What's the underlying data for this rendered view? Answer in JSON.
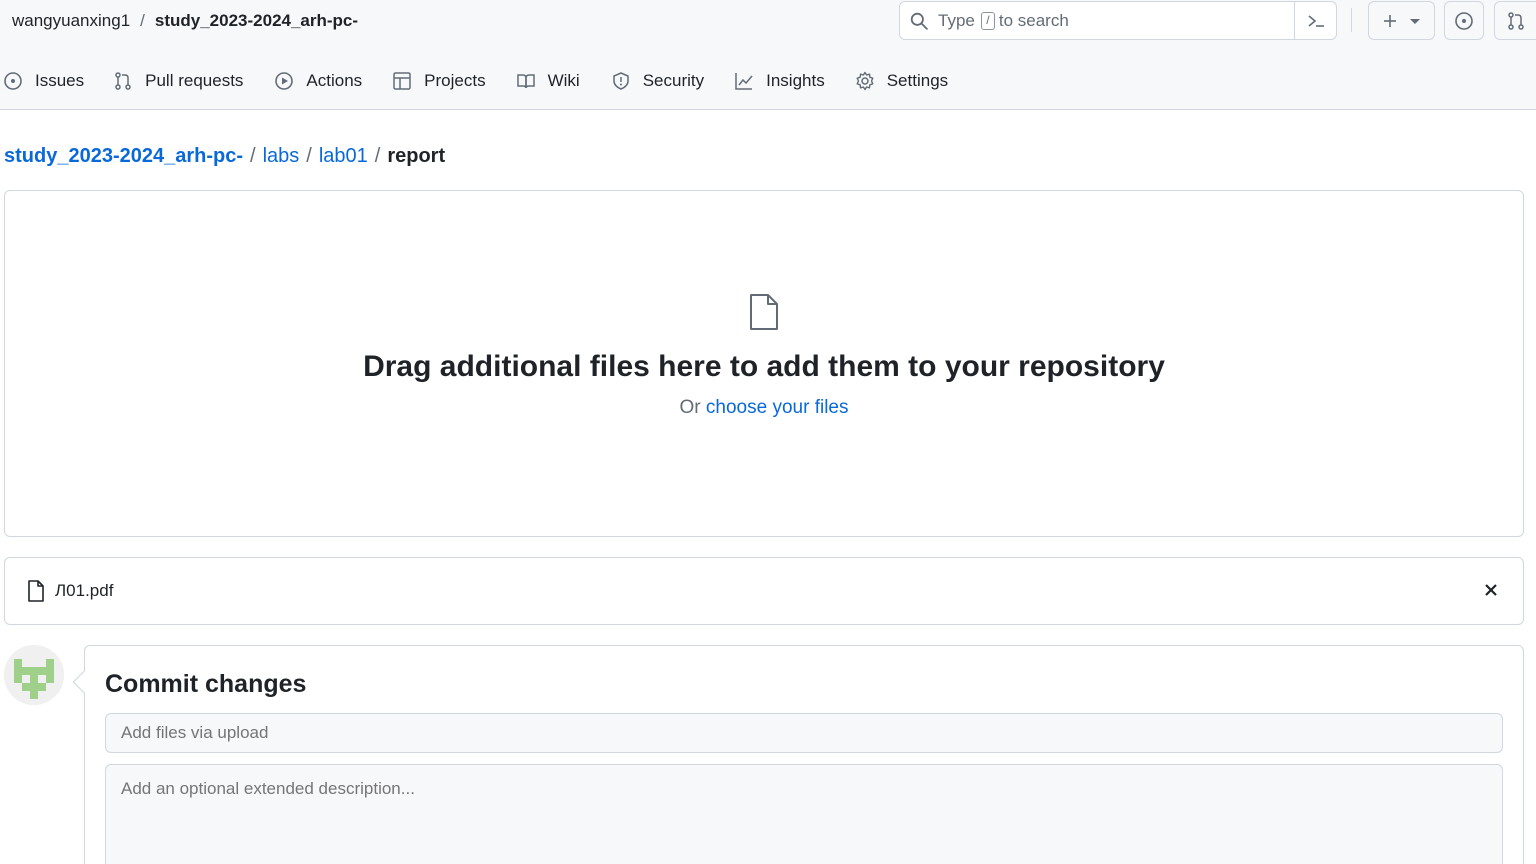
{
  "header": {
    "owner": "wangyuanxing1",
    "separator": "/",
    "repo": "study_2023-2024_arh-pc-",
    "search": {
      "prefix": "Type",
      "key": "/",
      "suffix": "to search"
    },
    "icons": [
      "search-icon",
      "terminal-icon",
      "plus-icon",
      "caret-down-icon",
      "issue-icon",
      "pull-request-icon"
    ]
  },
  "nav": {
    "tabs": [
      {
        "label": "Issues",
        "icon": "issue-opened-icon"
      },
      {
        "label": "Pull requests",
        "icon": "git-pull-request-icon"
      },
      {
        "label": "Actions",
        "icon": "play-icon"
      },
      {
        "label": "Projects",
        "icon": "table-icon"
      },
      {
        "label": "Wiki",
        "icon": "book-icon"
      },
      {
        "label": "Security",
        "icon": "shield-icon"
      },
      {
        "label": "Insights",
        "icon": "graph-icon"
      },
      {
        "label": "Settings",
        "icon": "gear-icon"
      }
    ]
  },
  "breadcrumb": {
    "root": "study_2023-2024_arh-pc-",
    "parts": [
      "labs",
      "lab01"
    ],
    "current": "report",
    "sep": "/"
  },
  "dropzone": {
    "title": "Drag additional files here to add them to your repository",
    "prefix": "Or",
    "link": "choose your files"
  },
  "files": [
    {
      "name": "Л01.pdf"
    }
  ],
  "commit": {
    "title": "Commit changes",
    "summary_placeholder": "Add files via upload",
    "description_placeholder": "Add an optional extended description..."
  },
  "colors": {
    "link": "#0969da",
    "text": "#1f2328",
    "muted": "#636c76",
    "border": "#d0d7de",
    "header_bg": "#f6f8fa",
    "avatar": "#9fd08a"
  }
}
